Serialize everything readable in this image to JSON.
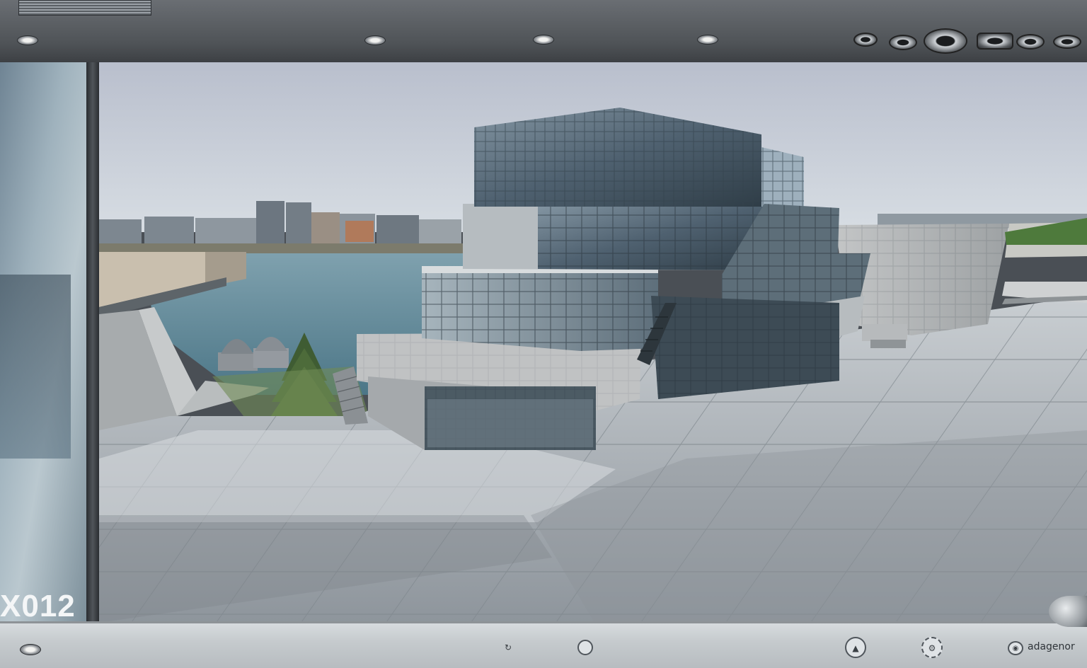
{
  "overlay": {
    "room_number": "X012",
    "corner_label": "adagenor"
  },
  "icons": {
    "sill_button_1": "refresh-icon",
    "sill_button_2": "circle-icon",
    "sill_button_3": "compass-icon",
    "sill_button_4": "settings-icon",
    "sill_button_5": "eye-icon"
  },
  "colors": {
    "sky_top": "#b9bfcd",
    "sky_bottom": "#d7dde3",
    "water": "#5d8596",
    "plaza": "#a7adb3",
    "glass": "#5f7280",
    "concrete": "#b8bbbd",
    "tree": "#4d6b3a"
  }
}
